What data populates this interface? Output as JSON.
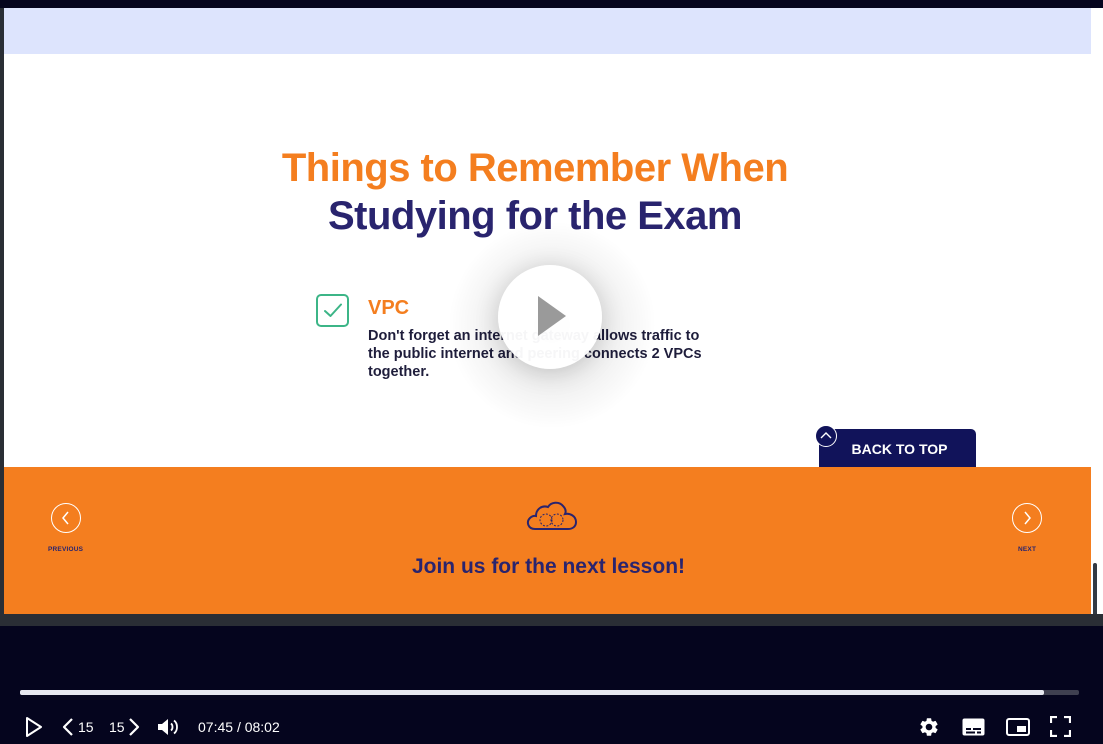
{
  "slide": {
    "title_line1": "Things to Remember When",
    "title_line2": "Studying for the Exam",
    "item": {
      "title": "VPC",
      "text": "Don't forget an internet gateway allows traffic to the public internet and peering connects 2 VPCs together."
    },
    "back_to_top": "BACK TO TOP"
  },
  "footer": {
    "previous_label": "PREVIOUS",
    "next_label": "NEXT",
    "message": "Join us for the next lesson!"
  },
  "player": {
    "rewind_label": "15",
    "forward_label": "15",
    "current_time": "07:45",
    "separator": "/",
    "duration": "08:02",
    "progress": 0.967
  },
  "icons": {
    "big_play": "play-icon",
    "check": "checkbox-check-icon",
    "cloud": "cloud-icon",
    "prev": "chevron-left-icon",
    "next": "chevron-right-icon",
    "play": "play-icon",
    "rewind": "rewind-15-icon",
    "forward": "forward-15-icon",
    "volume": "volume-icon",
    "settings": "gear-icon",
    "captions": "captions-icon",
    "pip": "picture-in-picture-icon",
    "fullscreen": "fullscreen-icon"
  },
  "colors": {
    "orange": "#f47e1f",
    "navy": "#29246e",
    "band": "#dde4fd",
    "check_green": "#3cb587",
    "player_bg": "#05051e"
  }
}
